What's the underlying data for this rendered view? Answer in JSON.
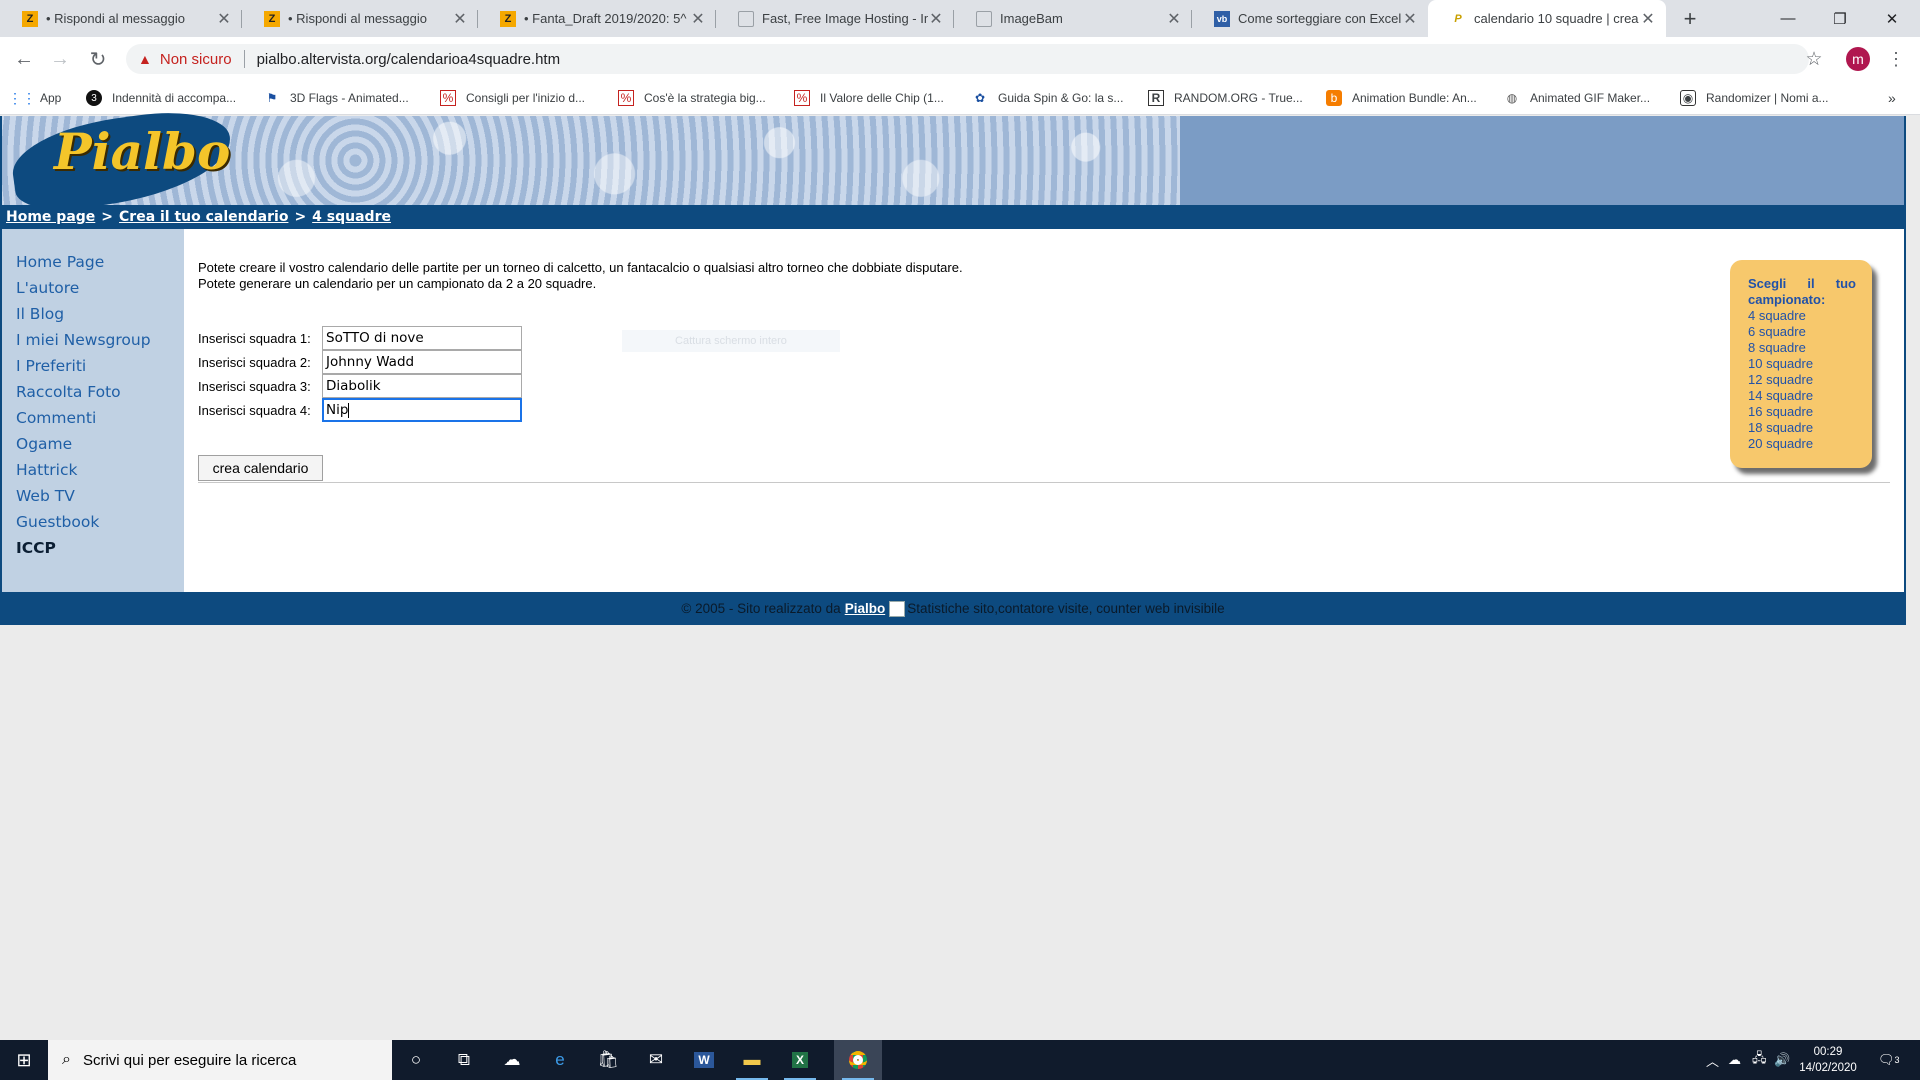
{
  "browser": {
    "tabs": [
      {
        "title": "• Rispondi al messaggio",
        "icon": "z-icon"
      },
      {
        "title": "• Rispondi al messaggio",
        "icon": "z-icon"
      },
      {
        "title": "• Fanta_Draft 2019/2020: 5^ ",
        "icon": "z-icon"
      },
      {
        "title": "Fast, Free Image Hosting - Im",
        "icon": "page-icon"
      },
      {
        "title": "ImageBam",
        "icon": "page-icon"
      },
      {
        "title": "Come sorteggiare con Excel |",
        "icon": "vb-icon"
      },
      {
        "title": "calendario 10 squadre | crea",
        "icon": "pialbo-icon"
      }
    ],
    "security_label": "Non sicuro",
    "url": "pialbo.altervista.org/calendarioa4squadre.htm",
    "profile_initial": "m",
    "bookmarks": [
      "App",
      "Indennità di accompa...",
      "3D Flags - Animated...",
      "Consigli per l'inizio d...",
      "Cos'è la strategia big...",
      "Il Valore delle Chip (1...",
      "Guida Spin & Go: la s...",
      "RANDOM.ORG - True...",
      "Animation Bundle: An...",
      "Animated GIF Maker...",
      "Randomizer | Nomi a..."
    ],
    "bookmarks_more": "»"
  },
  "site": {
    "logo": "Pialbo",
    "breadcrumb": {
      "home": "Home page",
      "sep": ">",
      "crea": "Crea il tuo calendario",
      "current": "4 squadre"
    },
    "sidebar": [
      "Home Page",
      "L'autore",
      "Il Blog",
      "I miei Newsgroup",
      "I Preferiti",
      "Raccolta Foto",
      "Commenti",
      "Ogame",
      "Hattrick",
      "Web TV",
      "Guestbook",
      "ICCP"
    ],
    "intro_line1": "Potete creare il vostro calendario delle partite per un torneo di calcetto, un fantacalcio o qualsiasi altro torneo che dobbiate disputare.",
    "intro_line2": "Potete generare un calendario per un campionato da 2 a 20 squadre.",
    "form": {
      "rows": [
        {
          "label": "Inserisci squadra 1:",
          "value": "SoTTO di nove"
        },
        {
          "label": "Inserisci squadra 2:",
          "value": "Johnny Wadd"
        },
        {
          "label": "Inserisci squadra 3:",
          "value": "Diabolik"
        },
        {
          "label": "Inserisci squadra 4:",
          "value": "Nip"
        }
      ],
      "submit_label": "crea calendario"
    },
    "ghost_overlay": "Cattura schermo intero",
    "choose_box": {
      "title_words": [
        "Scegli",
        "il",
        "tuo"
      ],
      "title_line2": "campionato:",
      "options": [
        "4 squadre",
        "6 squadre",
        "8 squadre",
        "10 squadre",
        "12 squadre",
        "14 squadre",
        "16 squadre",
        "18 squadre",
        "20 squadre"
      ]
    },
    "footer": {
      "prefix": "© 2005 - Sito realizzato da",
      "link": "Pialbo",
      "suffix": "Statistiche sito,contatore visite, counter web invisibile"
    }
  },
  "taskbar": {
    "search_placeholder": "Scrivi qui per eseguire la ricerca",
    "time": "00:29",
    "date": "14/02/2020",
    "notification_count": "3"
  }
}
